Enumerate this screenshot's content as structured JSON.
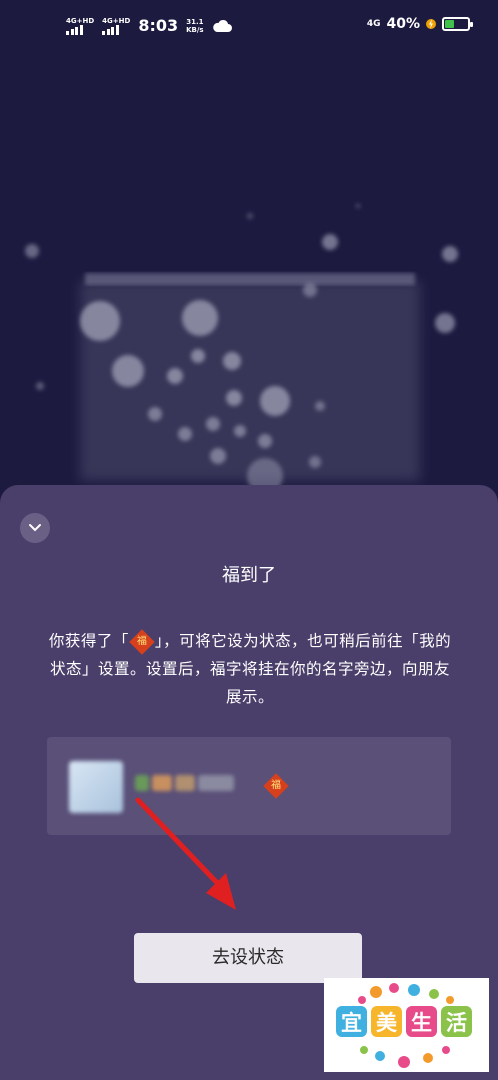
{
  "status_bar": {
    "sim1": "4G+HD",
    "sim2": "4G+HD",
    "time": "8:03",
    "speed_value": "31.1",
    "speed_unit": "KB/s",
    "network": "4G",
    "battery_percent": "40%",
    "battery_level": 0.4
  },
  "sheet": {
    "title": "福到了",
    "desc_part1": "你获得了「",
    "badge_char": "福",
    "desc_part2": "」，可将它设为状态，也可稍后前往「我的状态」设置。设置后，福字将挂在你的名字旁边，向朋友展示。",
    "button_label": "去设状态"
  },
  "watermark": {
    "chars": [
      "宜",
      "美",
      "生",
      "活"
    ]
  },
  "colors": {
    "background": "#1c1a3f",
    "sheet": "#4a3f6a",
    "badge": "#d6401c",
    "arrow": "#e02020",
    "battery": "#3ec24a"
  }
}
